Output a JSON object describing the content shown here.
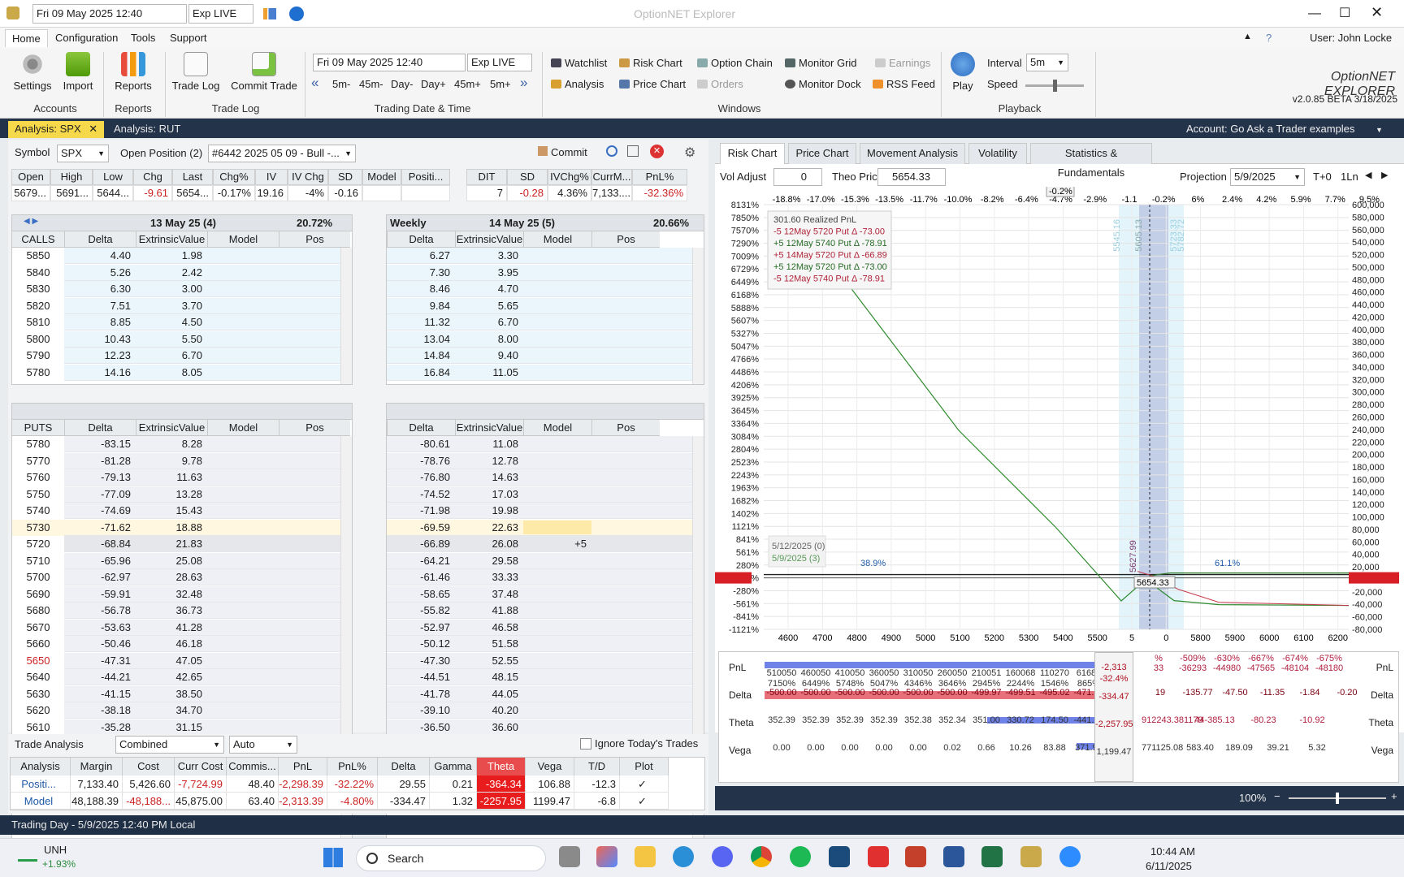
{
  "titlebar": {
    "datetime": "Fri 09 May 2025 12:40",
    "exp": "Exp LIVE",
    "app_title": "OptionNET Explorer"
  },
  "menu": {
    "items": [
      "Home",
      "Configuration",
      "Tools",
      "Support"
    ],
    "user": "User: John Locke"
  },
  "ribbon": {
    "settings": "Settings",
    "import": "Import",
    "accounts": "Accounts",
    "reports": "Reports",
    "reports_grp": "Reports",
    "trade_log": "Trade Log",
    "commit_trade": "Commit Trade",
    "trade_log_grp": "Trade Log",
    "date": "Fri 09 May 2025 12:40",
    "exp": "Exp LIVE",
    "steps": [
      "5m-",
      "45m-",
      "Day-",
      "Day+",
      "45m+",
      "5m+"
    ],
    "trading_grp": "Trading Date & Time",
    "windows": [
      "Watchlist",
      "Risk Chart",
      "Option Chain",
      "Monitor Grid",
      "Earnings",
      "Analysis",
      "Price Chart",
      "Orders",
      "Monitor Dock",
      "RSS Feed"
    ],
    "windows_grp": "Windows",
    "play": "Play",
    "interval_label": "Interval",
    "interval": "5m",
    "speed": "Speed",
    "playback_grp": "Playback",
    "version": "v2.0.85 BETA 3/18/2025",
    "logo": "OptionNET EXPLORER"
  },
  "tabs": {
    "a": "Analysis: SPX",
    "b": "Analysis: RUT",
    "account": "Account: Go Ask a Trader examples"
  },
  "symbolbar": {
    "symbol_label": "Symbol",
    "symbol": "SPX",
    "open_pos": "Open Position (2)",
    "position": "#6442 2025 05 09 - Bull -...",
    "commit": "Commit"
  },
  "quote": {
    "headers": [
      "Open",
      "High",
      "Low",
      "Chg",
      "Last",
      "Chg%",
      "IV",
      "IV Chg",
      "SD",
      "Model",
      "Positi..."
    ],
    "values": [
      "5679...",
      "5691...",
      "5644...",
      "-9.61",
      "5654...",
      "-0.17%",
      "19.16",
      "-4%",
      "-0.16",
      "",
      ""
    ]
  },
  "quote2": {
    "headers": [
      "DIT",
      "SD",
      "IVChg%",
      "CurrM...",
      "PnL%"
    ],
    "values": [
      "7",
      "-0.28",
      "4.36%",
      "7,133....",
      "-32.36%"
    ]
  },
  "chain": {
    "exp1": "13 May 25 (4)",
    "exp1_iv": "20.72%",
    "weekly": "Weekly",
    "exp2": "14 May 25 (5)",
    "exp2_iv": "20.66%",
    "cols": [
      "Delta",
      "ExtrinsicValue",
      "Model",
      "Pos"
    ],
    "calls_label": "CALLS",
    "puts_label": "PUTS",
    "calls": [
      [
        "5850",
        "4.40",
        "1.98",
        "6.27",
        "3.30"
      ],
      [
        "5840",
        "5.26",
        "2.42",
        "7.30",
        "3.95"
      ],
      [
        "5830",
        "6.30",
        "3.00",
        "8.46",
        "4.70"
      ],
      [
        "5820",
        "7.51",
        "3.70",
        "9.84",
        "5.65"
      ],
      [
        "5810",
        "8.85",
        "4.50",
        "11.32",
        "6.70"
      ],
      [
        "5800",
        "10.43",
        "5.50",
        "13.04",
        "8.00"
      ],
      [
        "5790",
        "12.23",
        "6.70",
        "14.84",
        "9.40"
      ],
      [
        "5780",
        "14.16",
        "8.05",
        "16.84",
        "11.05"
      ]
    ],
    "puts": [
      [
        "5780",
        "-83.15",
        "8.28",
        "-80.61",
        "11.08"
      ],
      [
        "5770",
        "-81.28",
        "9.78",
        "-78.76",
        "12.78"
      ],
      [
        "5760",
        "-79.13",
        "11.63",
        "-76.80",
        "14.63"
      ],
      [
        "5750",
        "-77.09",
        "13.28",
        "-74.52",
        "17.03"
      ],
      [
        "5740",
        "-74.69",
        "15.43",
        "-71.98",
        "19.98"
      ],
      [
        "5730",
        "-71.62",
        "18.88",
        "-69.59",
        "22.63"
      ],
      [
        "5720",
        "-68.84",
        "21.83",
        "-66.89",
        "26.08"
      ],
      [
        "5710",
        "-65.96",
        "25.08",
        "-64.21",
        "29.58"
      ],
      [
        "5700",
        "-62.97",
        "28.63",
        "-61.46",
        "33.33"
      ],
      [
        "5690",
        "-59.91",
        "32.48",
        "-58.65",
        "37.48"
      ],
      [
        "5680",
        "-56.78",
        "36.73",
        "-55.82",
        "41.88"
      ],
      [
        "5670",
        "-53.63",
        "41.28",
        "-52.97",
        "46.58"
      ],
      [
        "5660",
        "-50.46",
        "46.18",
        "-50.12",
        "51.58"
      ],
      [
        "5650",
        "-47.31",
        "47.05",
        "-47.30",
        "52.55"
      ],
      [
        "5640",
        "-44.21",
        "42.65",
        "-44.51",
        "48.15"
      ],
      [
        "5630",
        "-41.15",
        "38.50",
        "-41.78",
        "44.05"
      ],
      [
        "5620",
        "-38.18",
        "34.70",
        "-39.10",
        "40.20"
      ],
      [
        "5610",
        "-35.28",
        "31.15",
        "-36.50",
        "36.60"
      ]
    ],
    "pos_5720": "+5"
  },
  "trade": {
    "label": "Trade Analysis",
    "mode": "Combined",
    "auto": "Auto",
    "ignore": "Ignore Today's Trades",
    "headers": [
      "Analysis",
      "Margin",
      "Cost",
      "Curr Cost",
      "Commis...",
      "PnL",
      "PnL%",
      "Delta",
      "Gamma",
      "Theta",
      "Vega",
      "T/D",
      "Plot"
    ],
    "rows": [
      [
        "Positi...",
        "7,133.40",
        "5,426.60",
        "-7,724.99",
        "48.40",
        "-2,298.39",
        "-32.22%",
        "29.55",
        "0.21",
        "-364.34",
        "106.88",
        "-12.3",
        "✓"
      ],
      [
        "Model",
        "48,188.39",
        "-48,188...",
        "45,875.00",
        "63.40",
        "-2,313.39",
        "-4.80%",
        "-334.47",
        "1.32",
        "-2257.95",
        "1199.47",
        "-6.8",
        "✓"
      ]
    ]
  },
  "status": {
    "text": "Trading Day - 5/9/2025 12:40 PM Local",
    "zoom": "100%"
  },
  "right": {
    "tabs": [
      "Risk Chart",
      "Price Chart",
      "Movement Analysis",
      "Volatility",
      "Statistics & Fundamentals"
    ],
    "vol_adjust": "Vol Adjust",
    "vol_val": "0",
    "theo": "Theo Price",
    "theo_val": "5654.33",
    "projection": "Projection",
    "proj_val": "5/9/2025",
    "t0": "T+0",
    "ln": "1Ln",
    "pct_top": [
      "-18.8%",
      "-17.0%",
      "-15.3%",
      "-13.5%",
      "-11.7%",
      "-10.0%",
      "-8.2%",
      "-6.4%",
      "-4.7%",
      "-2.9%",
      "-1.1",
      "-0.2%",
      "6%",
      "2.4%",
      "4.2%",
      "5.9%",
      "7.7%",
      "9.5%"
    ],
    "left_axis": [
      "8131%",
      "7850%",
      "7570%",
      "7290%",
      "7009%",
      "6729%",
      "6449%",
      "6168%",
      "5888%",
      "5607%",
      "5327%",
      "5047%",
      "4766%",
      "4486%",
      "4206%",
      "3925%",
      "3645%",
      "3364%",
      "3084%",
      "2804%",
      "2523%",
      "2243%",
      "1963%",
      "1682%",
      "1402%",
      "1121%",
      "841%",
      "561%",
      "280%",
      "-32%",
      "-280%",
      "-561%",
      "-841%",
      "-1121%"
    ],
    "right_axis": [
      "600,000",
      "580,000",
      "560,000",
      "540,000",
      "520,000",
      "500,000",
      "480,000",
      "460,000",
      "440,000",
      "420,000",
      "400,000",
      "380,000",
      "360,000",
      "340,000",
      "320,000",
      "300,000",
      "280,000",
      "260,000",
      "240,000",
      "220,000",
      "200,000",
      "180,000",
      "160,000",
      "140,000",
      "120,000",
      "100,000",
      "80,000",
      "60,000",
      "40,000",
      "20,000",
      "-2,313",
      "-20,000",
      "-40,000",
      "-60,000",
      "-80,000"
    ],
    "x_axis": [
      "4600",
      "4700",
      "4800",
      "4900",
      "5000",
      "5100",
      "5200",
      "5300",
      "5400",
      "5500",
      "5",
      "0",
      "5800",
      "5900",
      "6000",
      "6100",
      "6200"
    ],
    "legend": [
      "301.60 Realized PnL",
      "-5 12May 5720 Put Δ  -73.00",
      "+5 12May 5740 Put Δ  -78.91",
      "+5 14May 5720 Put Δ  -66.89",
      "+5 12May 5720 Put Δ  -73.00",
      "-5 12May 5740 Put Δ  -78.91"
    ],
    "dates": [
      "5/12/2025 (0)",
      "5/9/2025 (3)"
    ],
    "prob_left": "38.9%",
    "prob_right": "61.1%",
    "cursor_price": "5654.33",
    "cursor_low": "5627.99",
    "vlabels": [
      "5545.16",
      "5605.13",
      "5723.33",
      "5782.72"
    ],
    "hover": {
      "pnl": "-2,313",
      "pct": "-32.4%",
      "delta": "-334.47",
      "theta": "-2,257.95",
      "vega": "1,199.47"
    },
    "pnl_row1": [
      "510050",
      "460050",
      "410050",
      "360050",
      "310050",
      "260050",
      "210051",
      "160068",
      "110270",
      "61689",
      "17"
    ],
    "pnl_row2": [
      "7150%",
      "6449%",
      "5748%",
      "5047%",
      "4346%",
      "3646%",
      "2945%",
      "2244%",
      "1546%",
      "865%",
      "24"
    ],
    "pnl_right1": [
      "%",
      "-509%",
      "-630%",
      "-667%",
      "-674%",
      "-675%"
    ],
    "pnl_right2": [
      "33",
      "-36293",
      "-44980",
      "-47565",
      "-48104",
      "-48180"
    ],
    "delta_row": [
      "-500.00",
      "-500.00",
      "-500.00",
      "-500.00",
      "-500.00",
      "-500.00",
      "-499.97",
      "-499.51",
      "-495.02",
      "-471.13",
      "-39"
    ],
    "delta_right": [
      "19",
      "-135.77",
      "-47.50",
      "-11.35",
      "-1.84",
      "-0.20"
    ],
    "theta_row": [
      "352.39",
      "352.39",
      "352.39",
      "352.39",
      "352.38",
      "352.34",
      "351.00",
      "330.72",
      "174.50",
      "-441.14",
      "-16"
    ],
    "theta_right": [
      "912243.381179",
      "44-385.13",
      "-80.23",
      "-10.92"
    ],
    "vega_row": [
      "0.00",
      "0.00",
      "0.00",
      "0.00",
      "0.00",
      "0.02",
      "0.66",
      "10.26",
      "83.88",
      "371.91",
      "92"
    ],
    "vega_right": [
      "771125.08",
      "583.40",
      "189.09",
      "39.21",
      "5.32"
    ],
    "row_labels": [
      "PnL",
      "Delta",
      "Theta",
      "Vega"
    ]
  },
  "taskbar": {
    "ticker": "UNH",
    "ticker_chg": "+1.93%",
    "search": "Search",
    "time": "10:44 AM",
    "date": "6/11/2025"
  },
  "colors": {
    "green": "#2e8b2e",
    "red": "#cc2222",
    "navy": "#23334a",
    "tab_yellow": "#f6d94a"
  }
}
